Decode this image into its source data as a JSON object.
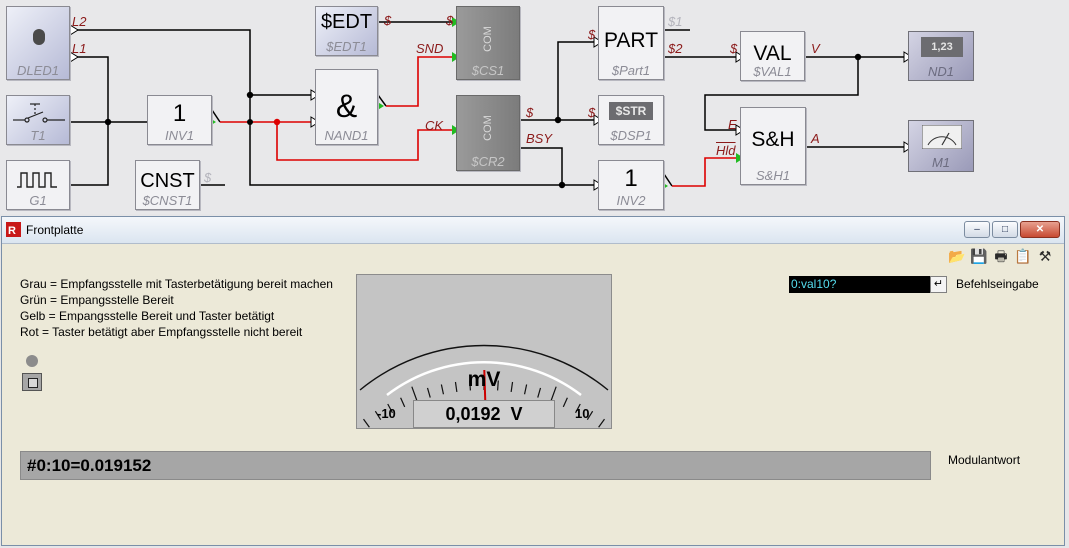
{
  "diagram": {
    "blocks": {
      "dled1": {
        "name": "DLED1"
      },
      "t1": {
        "name": "T1"
      },
      "g1": {
        "name": "G1"
      },
      "inv1": {
        "symbol": "1",
        "name": "INV1"
      },
      "cnst1": {
        "symbol": "CNST",
        "name": "$CNST1"
      },
      "edt1": {
        "symbol": "$EDT",
        "name": "$EDT1"
      },
      "nand1": {
        "symbol": "&",
        "name": "NAND1"
      },
      "cs1": {
        "symbol": "COM",
        "name": "$CS1"
      },
      "cr2": {
        "symbol": "COM",
        "name": "$CR2"
      },
      "part1": {
        "symbol": "PART",
        "name": "$Part1"
      },
      "dsp1": {
        "display": "$STR",
        "name": "$DSP1"
      },
      "inv2": {
        "symbol": "1",
        "name": "INV2"
      },
      "val1": {
        "symbol": "VAL",
        "name": "$VAL1"
      },
      "sh1": {
        "symbol": "S&H",
        "name": "S&H1"
      },
      "nd1": {
        "display": "1,23",
        "name": "ND1"
      },
      "m1": {
        "name": "M1"
      }
    },
    "port_labels": {
      "l2": "L2",
      "l1": "L1",
      "cnst_out": "$",
      "edt_out": "$",
      "cs1_in": "$",
      "snd": "SND",
      "ck": "CK",
      "cr2_out": "$",
      "bsy": "BSY",
      "part_in": "$",
      "p1": "$1",
      "p2": "$2",
      "dsp_in": "$",
      "val_in": "$",
      "val_out": "V",
      "e": "E",
      "hld": "Hld",
      "a": "A"
    }
  },
  "window": {
    "title": "Frontplatte",
    "controls": {
      "minimize": "–",
      "maximize": "□",
      "close": "✕"
    },
    "toolbar": {
      "open": "📂",
      "save": "💾",
      "print": "🖶",
      "clipboard": "📋",
      "tools": "⚒"
    },
    "legend": [
      "Grau = Empfangsstelle mit Tasterbetätigung bereit machen",
      "Grün = Empangsstelle Bereit",
      "Gelb = Empangsstelle Bereit und Taster betätigt",
      "Rot   = Taster betätigt aber Empfangsstelle nicht bereit"
    ],
    "meter": {
      "unit": "mV",
      "min": "-10",
      "max": "10",
      "readout": "0,0192  V",
      "needle_value": 0.0192
    },
    "command": {
      "value": "0:val10?",
      "label": "Befehlseingabe",
      "enter_symbol": "↵"
    },
    "response": {
      "value": "#0:10=0.019152",
      "label": "Modulantwort"
    }
  },
  "colors": {
    "wire": "#000000",
    "active_wire": "#dd0000",
    "port_active": "#22bb22",
    "needle": "#cc0000",
    "label": "#8b1a1a"
  }
}
